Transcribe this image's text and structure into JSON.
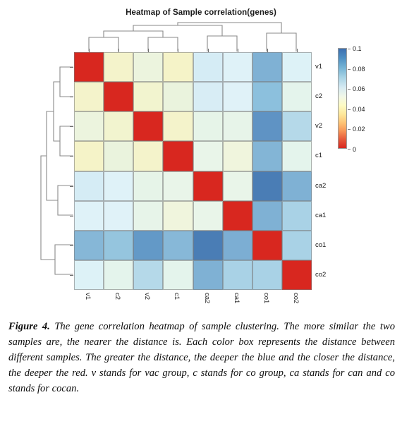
{
  "figure": {
    "title": "Heatmap of Sample correlation(genes)"
  },
  "caption": {
    "label": "Figure 4.",
    "text": " The gene correlation heatmap of sample clustering. The more similar the two samples are, the nearer the distance is. Each color box represents the distance between different samples. The greater the distance, the deeper the blue and the closer the distance, the deeper the red. v stands for vac group, c stands for co group, ca stands for can and co stands for cocan."
  },
  "colorbar": {
    "ticks": [
      "0.1",
      "0.08",
      "0.06",
      "0.04",
      "0.02",
      "0"
    ],
    "min_label": "0",
    "max_label": "0.1",
    "low_color": "#d8271f",
    "high_color": "#3c6fb0"
  },
  "chart_data": {
    "type": "heatmap",
    "title": "Heatmap of Sample correlation(genes)",
    "xlabel": "",
    "ylabel": "",
    "colormap": "RdYlBu",
    "zlim": [
      0,
      0.1
    ],
    "colorbar_ticks": [
      0.1,
      0.08,
      0.06,
      0.04,
      0.02,
      0
    ],
    "row_labels": [
      "v1",
      "c2",
      "v2",
      "c1",
      "ca2",
      "ca1",
      "co1",
      "co2"
    ],
    "col_labels": [
      "v1",
      "c2",
      "v2",
      "c1",
      "ca2",
      "ca1",
      "co1",
      "co2"
    ],
    "values": [
      [
        0.0,
        0.043,
        0.039,
        0.042,
        0.07,
        0.072,
        0.086,
        0.074
      ],
      [
        0.043,
        0.0,
        0.042,
        0.04,
        0.071,
        0.072,
        0.084,
        0.057
      ],
      [
        0.039,
        0.042,
        0.0,
        0.043,
        0.053,
        0.053,
        0.092,
        0.08
      ],
      [
        0.042,
        0.04,
        0.043,
        0.0,
        0.054,
        0.049,
        0.085,
        0.056
      ],
      [
        0.07,
        0.071,
        0.053,
        0.054,
        0.0,
        0.052,
        0.098,
        0.086
      ],
      [
        0.072,
        0.072,
        0.053,
        0.049,
        0.052,
        0.0,
        0.086,
        0.081
      ],
      [
        0.086,
        0.084,
        0.092,
        0.085,
        0.098,
        0.086,
        0.0,
        0.08
      ],
      [
        0.074,
        0.057,
        0.08,
        0.056,
        0.086,
        0.081,
        0.08,
        0.0
      ]
    ],
    "colors": [
      [
        "#d8271f",
        "#f4f3cb",
        "#ecf4de",
        "#f5f3c8",
        "#d5ecf5",
        "#dff2f8",
        "#7fb1d4",
        "#ddf2f7"
      ],
      [
        "#f4f3cb",
        "#d8271f",
        "#f2f4cf",
        "#eaf3dd",
        "#d8edf5",
        "#e0f2f8",
        "#8cc0dd",
        "#e4f4ec"
      ],
      [
        "#ecf4de",
        "#f2f4cf",
        "#d8271f",
        "#f4f3cb",
        "#e6f4e8",
        "#e7f4e9",
        "#5f93c4",
        "#b5d9e9"
      ],
      [
        "#f5f3c8",
        "#eaf3dd",
        "#f4f3cb",
        "#d8271f",
        "#e9f5e9",
        "#f0f5dd",
        "#83b5d6",
        "#e4f4ec"
      ],
      [
        "#d5ecf5",
        "#dff2f8",
        "#e6f4e8",
        "#e9f5e9",
        "#d8271f",
        "#e9f5e9",
        "#4a7db5",
        "#7fb1d4"
      ],
      [
        "#dff2f8",
        "#e0f2f8",
        "#e7f4e9",
        "#f0f5dd",
        "#e9f5e9",
        "#d8271f",
        "#7fb1d4",
        "#a9d2e6"
      ],
      [
        "#86b7d7",
        "#95c5de",
        "#6399c7",
        "#87b8d8",
        "#4a7db5",
        "#7caed3",
        "#d8271f",
        "#a9d2e6"
      ],
      [
        "#ddf2f7",
        "#e4f4ec",
        "#b5d9e9",
        "#e4f4ec",
        "#7fb1d4",
        "#a9d2e6",
        "#a9d2e6",
        "#d8271f"
      ]
    ],
    "row_dendrogram": "((((v1,c2),(v2,c1)),(ca2,ca1)),(co1,co2))",
    "col_dendrogram": "((((v1,c2),(v2,c1)),(ca2,ca1)),(co1,co2))"
  }
}
